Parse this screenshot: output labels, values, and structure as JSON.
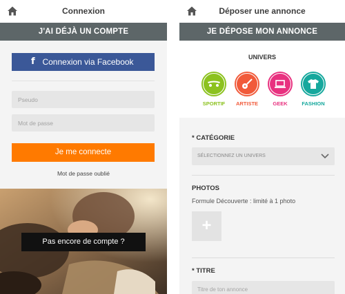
{
  "left_screen": {
    "header": {
      "title": "Connexion",
      "home_icon": "home-icon"
    },
    "section_title": "J'AI DÉJÀ UN COMPTE",
    "facebook_button": {
      "icon": "f",
      "label": "Connexion via Facebook",
      "color": "#3b5898"
    },
    "pseudo_placeholder": "Pseudo",
    "password_placeholder": "Mot de passe",
    "login_button": {
      "label": "Je me connecte",
      "color": "#ff7a00"
    },
    "forgot_password": "Mot de passe oublié",
    "signup_cta": "Pas encore de compte ?"
  },
  "right_screen": {
    "header": {
      "title": "Déposer une annonce",
      "home_icon": "home-icon"
    },
    "section_title": "JE DÉPOSE MON ANNONCE",
    "univers_label": "UNIVERS",
    "categories": [
      {
        "label": "SPORTIF",
        "color": "#8cc21f",
        "icon": "skateboard-icon"
      },
      {
        "label": "ARTISTE",
        "color": "#f15a3a",
        "icon": "guitar-icon"
      },
      {
        "label": "GEEK",
        "color": "#e8317f",
        "icon": "laptop-icon"
      },
      {
        "label": "FASHION",
        "color": "#16a89d",
        "icon": "tshirt-icon"
      }
    ],
    "categorie_label": "* CATÉGORIE",
    "categorie_select": "SÉLECTIONNEZ UN UNIVERS",
    "photos_label": "PHOTOS",
    "photos_sub": "Formule Découverte : limité à 1 photo",
    "add_photo_icon": "+",
    "titre_label": "* TITRE",
    "titre_placeholder": "Titre de ton annonce"
  },
  "colors": {
    "section_bar": "#5d6668",
    "background": "#f4f4f4"
  }
}
